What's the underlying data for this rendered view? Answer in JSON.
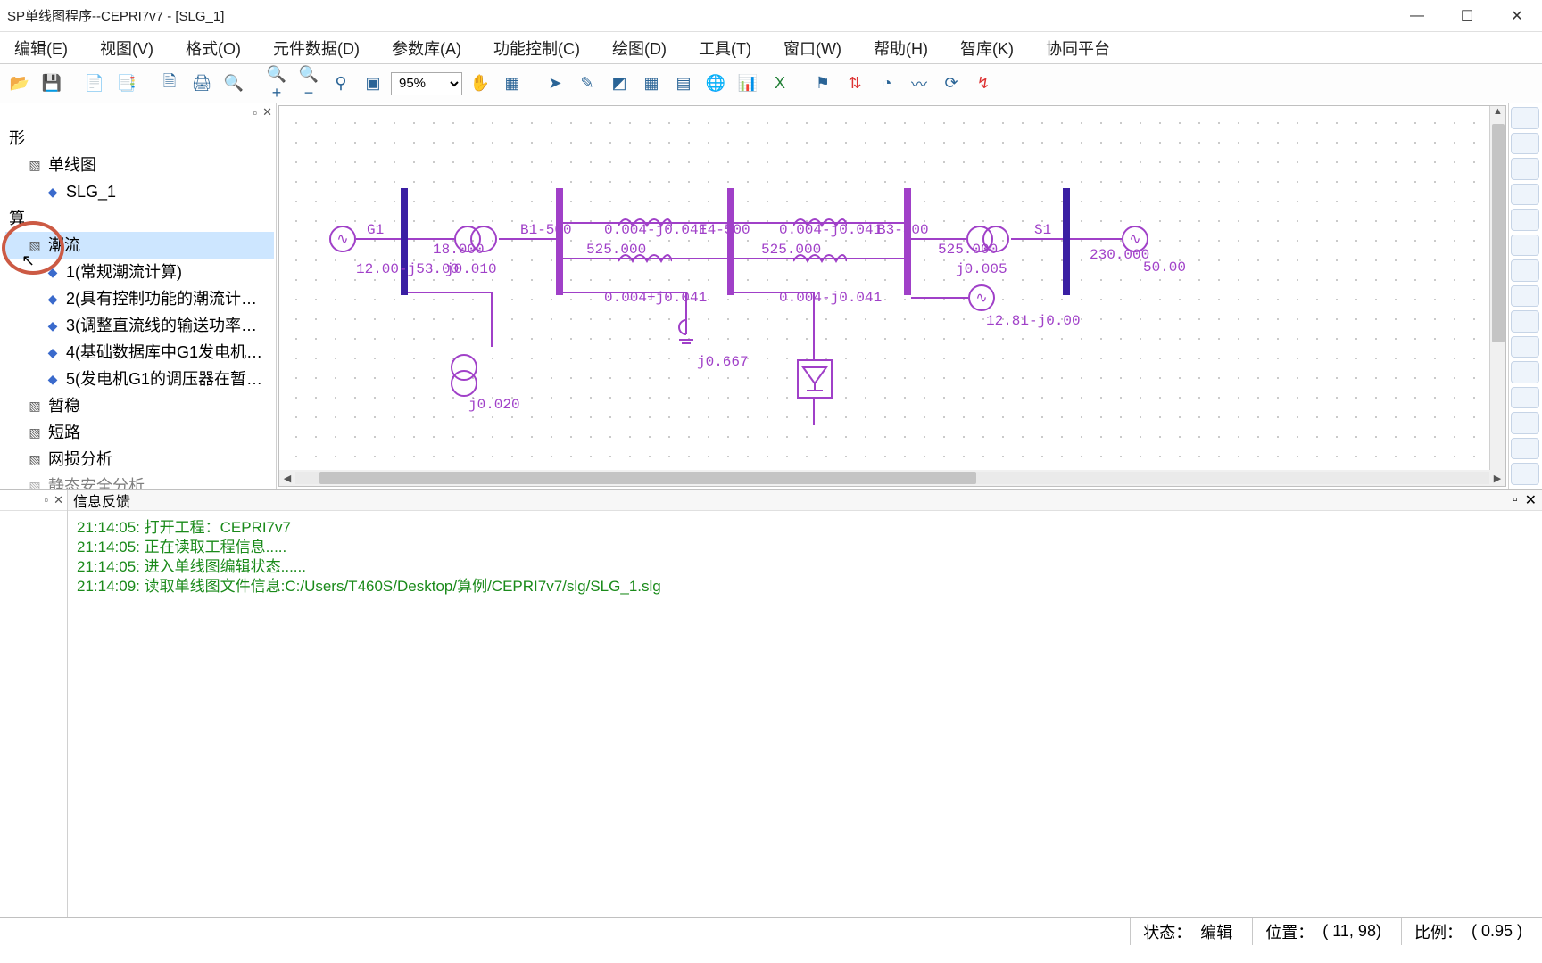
{
  "window": {
    "title": "SP单线图程序--CEPRI7v7 - [SLG_1]"
  },
  "menu": [
    "编辑(E)",
    "视图(V)",
    "格式(O)",
    "元件数据(D)",
    "参数库(A)",
    "功能控制(C)",
    "绘图(D)",
    "工具(T)",
    "窗口(W)",
    "帮助(H)",
    "智库(K)",
    "协同平台"
  ],
  "toolbar": {
    "zoom": "95%"
  },
  "tree": {
    "root_shape": "形",
    "single_line": "单线图",
    "slg": "SLG_1",
    "calc": "算",
    "chaoliu": "潮流",
    "items": [
      "1(常规潮流计算)",
      "2(具有控制功能的潮流计…",
      "3(调整直流线的输送功率…",
      "4(基础数据库中G1发电机…",
      "5(发电机G1的调压器在暂…"
    ],
    "zanwen": "暂稳",
    "duanlu": "短路",
    "wangsun": "网损分析",
    "jingtai": "静态安全分析"
  },
  "feedback_title": "信息反馈",
  "log": [
    "21:14:05: 打开工程：CEPRI7v7",
    "21:14:05: 正在读取工程信息.....",
    "21:14:05: 进入单线图编辑状态......",
    "21:14:09: 读取单线图文件信息:C:/Users/T460S/Desktop/算例/CEPRI7v7/slg/SLG_1.slg"
  ],
  "diagram": {
    "g1": "G1",
    "s1": "S1",
    "b1": "B1-500",
    "b4": "E4-500",
    "b3": "B3-500",
    "v1": "12.00-j53.00",
    "v2": "18.000",
    "v3": "j0.010",
    "z1": "0.004-j0.041",
    "z2": "0.004+j0.041",
    "z3": "0.004-j0.041",
    "z4": "0.004-j0.041",
    "p1": "525.000",
    "p2": "525.000",
    "p3": "525.000",
    "j005": "j0.005",
    "j020": "j0.020",
    "j667": "j0.667",
    "v230": "230.000",
    "v5000": "50.00",
    "gen_s": "12.81-j0.00"
  },
  "status": {
    "state_lbl": "状态：",
    "state_val": "编辑",
    "pos_lbl": "位置：",
    "pos_val": "( 11, 98)",
    "ratio_lbl": "比例：",
    "ratio_val": "( 0.95 )"
  }
}
